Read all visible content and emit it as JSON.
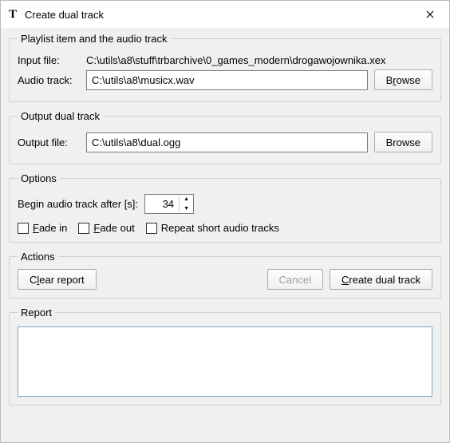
{
  "window": {
    "title": "Create dual track"
  },
  "group1": {
    "legend": "Playlist item and the audio track",
    "inputFileLabel": "Input file:",
    "inputFilePath": "C:\\utils\\a8\\stuff\\trbarchive\\0_games_modern\\drogawojownika.xex",
    "audioTrackLabel": "Audio track:",
    "audioTrackValue": "C:\\utils\\a8\\musicx.wav",
    "browseLabelPre": "B",
    "browseLabelU": "r",
    "browseLabelPost": "owse"
  },
  "group2": {
    "legend": "Output dual track",
    "outputFileLabel": "Output file:",
    "outputFileValue": "C:\\utils\\a8\\dual.ogg",
    "browseLabel": "Browse"
  },
  "group3": {
    "legend": "Options",
    "beginLabel": "Begin audio track after [s]:",
    "beginValue": "34",
    "fadeInU": "F",
    "fadeInPost": "ade in",
    "fadeOutU": "F",
    "fadeOutPost": "ade out",
    "repeatLabel": "Repeat short audio tracks"
  },
  "group4": {
    "legend": "Actions",
    "clearU": "l",
    "clearPre": "C",
    "clearPost": "ear report",
    "cancelLabel": "Cancel",
    "createU": "C",
    "createPost": "reate dual track"
  },
  "group5": {
    "legend": "Report"
  }
}
